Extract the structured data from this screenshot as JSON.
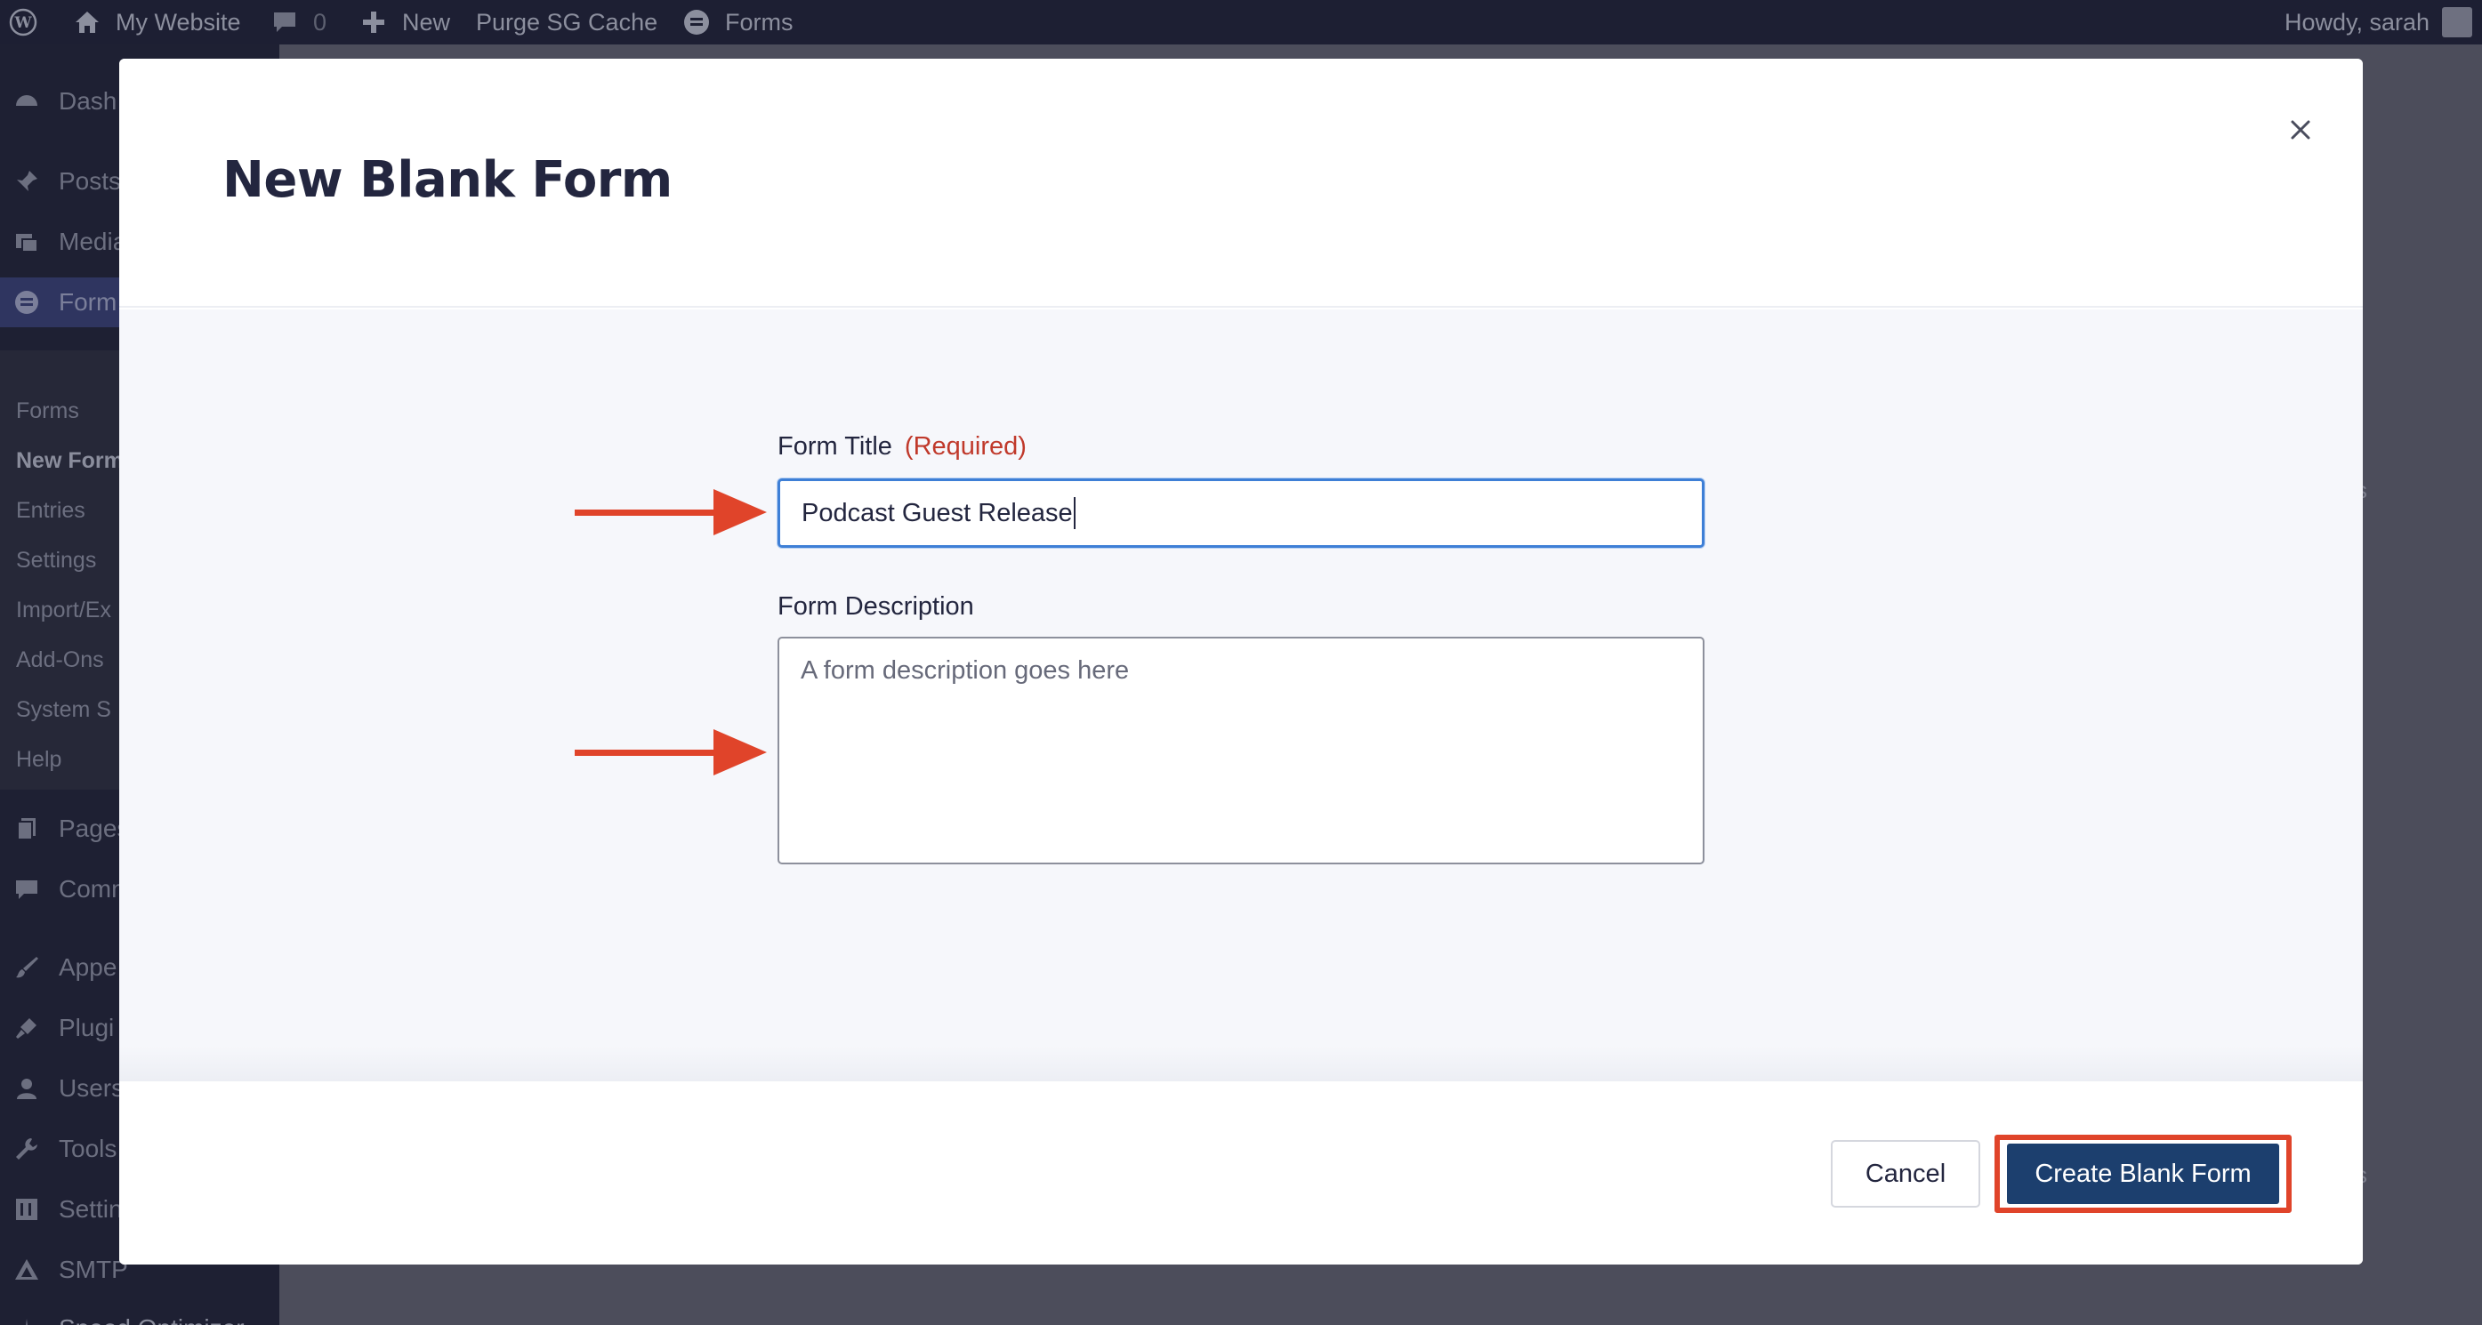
{
  "admin_bar": {
    "site_name": "My Website",
    "comments_count": "0",
    "new_label": "New",
    "purge_label": "Purge SG Cache",
    "forms_label": "Forms",
    "howdy": "Howdy, sarah"
  },
  "sidebar": {
    "items": [
      {
        "label": "Dash",
        "icon": "dashboard-icon"
      },
      {
        "label": "Posts",
        "icon": "pin-icon"
      },
      {
        "label": "Media",
        "icon": "media-icon"
      },
      {
        "label": "Form",
        "icon": "forms-icon"
      },
      {
        "label": "Pages",
        "icon": "pages-icon"
      },
      {
        "label": "Comm",
        "icon": "comments-icon"
      },
      {
        "label": "Appe",
        "icon": "brush-icon"
      },
      {
        "label": "Plugi",
        "icon": "plugin-icon"
      },
      {
        "label": "Users",
        "icon": "user-icon"
      },
      {
        "label": "Tools",
        "icon": "wrench-icon"
      },
      {
        "label": "Settin",
        "icon": "settings-icon"
      },
      {
        "label": "SMTP",
        "icon": "smtp-icon"
      },
      {
        "label": "Speed Optimizer",
        "icon": "speed-icon"
      }
    ],
    "sub_items": [
      "Forms",
      "New Form",
      "Entries",
      "Settings",
      "Import/Ex",
      "Add-Ons",
      "System S",
      "Help"
    ]
  },
  "modal": {
    "title": "New Blank Form",
    "form_title_label": "Form Title",
    "required_text": "(Required)",
    "form_title_value": "Podcast Guest Release",
    "form_description_label": "Form Description",
    "form_description_placeholder": "A form description goes here",
    "cancel_label": "Cancel",
    "create_label": "Create Blank Form"
  },
  "right_fragments": [
    "s",
    "s"
  ],
  "colors": {
    "annotation_red": "#e0442a",
    "primary_button": "#1c3f6e",
    "focus_blue": "#3e7fd6"
  }
}
